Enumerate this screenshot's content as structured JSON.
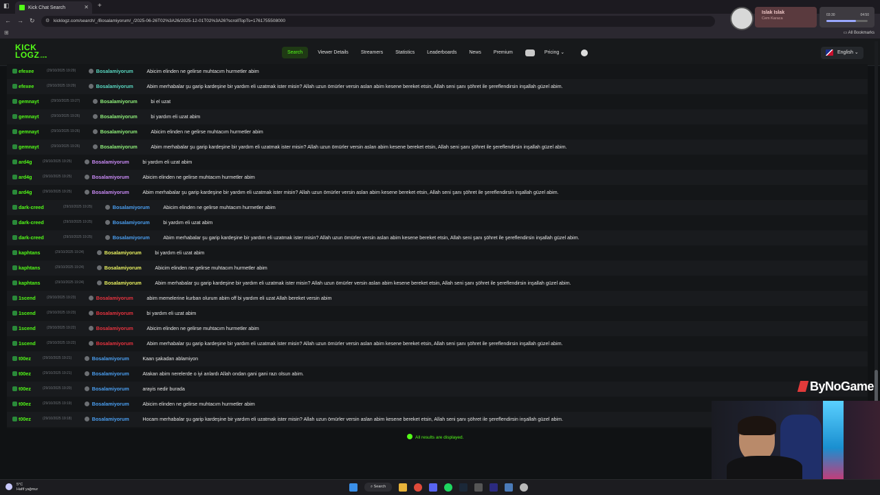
{
  "browser": {
    "tab_title": "Kick Chat Search",
    "url": "kicklogz.com/search/_/Bosalamiyorum/_/2025-06-26T02%3A26/2025-12-01T02%3A26?scrollTopTs=1761755508000",
    "all_bookmarks": "All Bookmarks"
  },
  "media": {
    "title": "Islak Islak",
    "artist": "Cem Karaca",
    "elapsed": "03:30",
    "duration": "04:50",
    "progress": 0.72
  },
  "site": {
    "logo_top": "KICK",
    "logo_bottom": "LOGZ",
    "logo_suffix": ".com",
    "nav": [
      "Search",
      "Viewer Details",
      "Streamers",
      "Statistics",
      "Leaderboards",
      "News",
      "Premium"
    ],
    "pricing": "Pricing",
    "language": "English"
  },
  "chat": {
    "rows": [
      {
        "user": "efexee",
        "ts": "(29/10/2025 19:29)",
        "target": "Bosalamiyorum",
        "color": "#5ad9c2",
        "msg": "Abicim elinden ne gelirse muhtacım hurmetler abim"
      },
      {
        "user": "efexee",
        "ts": "(29/10/2025 19:29)",
        "target": "Bosalamiyorum",
        "color": "#5ad9c2",
        "msg": "Abim merhabalar şu garip kardeşine bir yardım eli uzatmak ister misin? Allah uzun ömürler versin aslan abim kesene bereket etsin, Allah seni şanı şöhret ile şereflendirsin inşallah güzel abim."
      },
      {
        "user": "gemnayt",
        "ts": "(29/10/2025 19:27)",
        "target": "Bosalamiyorum",
        "color": "#8ff07a",
        "msg": "bi el uzat"
      },
      {
        "user": "gemnayt",
        "ts": "(29/10/2025 19:26)",
        "target": "Bosalamiyorum",
        "color": "#8ff07a",
        "msg": "bi yardım eli uzat abim"
      },
      {
        "user": "gemnayt",
        "ts": "(29/10/2025 19:26)",
        "target": "Bosalamiyorum",
        "color": "#8ff07a",
        "msg": "Abicim elinden ne gelirse muhtacım hurmetler abim"
      },
      {
        "user": "gemnayt",
        "ts": "(29/10/2025 19:26)",
        "target": "Bosalamiyorum",
        "color": "#8ff07a",
        "msg": "Abim merhabalar şu garip kardeşine bir yardım eli uzatmak ister misin? Allah uzun ömürler versin aslan abim kesene bereket etsin, Allah seni şanı şöhret ile şereflendirsin inşallah güzel abim."
      },
      {
        "user": "ard4g",
        "ts": "(29/10/2025 19:25)",
        "target": "Bosalamiyorum",
        "color": "#c98af5",
        "msg": "bi yardım eli uzat abim"
      },
      {
        "user": "ard4g",
        "ts": "(29/10/2025 19:25)",
        "target": "Bosalamiyorum",
        "color": "#c98af5",
        "msg": "Abicim elinden ne gelirse muhtacım hurmetler abim"
      },
      {
        "user": "ard4g",
        "ts": "(29/10/2025 19:25)",
        "target": "Bosalamiyorum",
        "color": "#c98af5",
        "msg": "Abim merhabalar şu garip kardeşine bir yardım eli uzatmak ister misin? Allah uzun ömürler versin aslan abim kesene bereket etsin, Allah seni şanı şöhret ile şereflendirsin inşallah güzel abim."
      },
      {
        "user": "dark-creed",
        "ts": "(29/10/2025 19:25)",
        "target": "Bosalamiyorum",
        "color": "#4a9ef0",
        "msg": "Abicim elinden ne gelirse muhtacım hurmetler abim"
      },
      {
        "user": "dark-creed",
        "ts": "(29/10/2025 19:25)",
        "target": "Bosalamiyorum",
        "color": "#4a9ef0",
        "msg": "bi yardım eli uzat abim"
      },
      {
        "user": "dark-creed",
        "ts": "(29/10/2025 19:25)",
        "target": "Bosalamiyorum",
        "color": "#4a9ef0",
        "msg": "Abim merhabalar şu garip kardeşine bir yardım eli uzatmak ister misin? Allah uzun ömürler versin aslan abim kesene bereket etsin, Allah seni şanı şöhret ile şereflendirsin inşallah güzel abim."
      },
      {
        "user": "kaphtans",
        "ts": "(29/10/2025 19:24)",
        "target": "Bosalamiyorum",
        "color": "#e8f060",
        "msg": "bi yardım eli uzat abim"
      },
      {
        "user": "kaphtans",
        "ts": "(29/10/2025 19:24)",
        "target": "Bosalamiyorum",
        "color": "#e8f060",
        "msg": "Abicim elinden ne gelirse muhtacım hurmetler abim"
      },
      {
        "user": "kaphtans",
        "ts": "(29/10/2025 19:24)",
        "target": "Bosalamiyorum",
        "color": "#e8f060",
        "msg": "Abim merhabalar şu garip kardeşine bir yardım eli uzatmak ister misin? Allah uzun ömürler versin aslan abim kesene bereket etsin, Allah seni şanı şöhret ile şereflendirsin inşallah güzel abim."
      },
      {
        "user": "1scend",
        "ts": "(29/10/2025 19:23)",
        "target": "Bosalamiyorum",
        "color": "#e8333f",
        "msg": "abim memelerine kurban olurum abim off bi yardım eli uzat Allah bereket versin abim"
      },
      {
        "user": "1scend",
        "ts": "(29/10/2025 19:23)",
        "target": "Bosalamiyorum",
        "color": "#e8333f",
        "msg": "bi yardım eli uzat abim"
      },
      {
        "user": "1scend",
        "ts": "(29/10/2025 19:22)",
        "target": "Bosalamiyorum",
        "color": "#e8333f",
        "msg": "Abicim elinden ne gelirse muhtacım hurmetler abim"
      },
      {
        "user": "1scend",
        "ts": "(29/10/2025 19:22)",
        "target": "Bosalamiyorum",
        "color": "#e8333f",
        "msg": "Abim merhabalar şu garip kardeşine bir yardım eli uzatmak ister misin? Allah uzun ömürler versin aslan abim kesene bereket etsin, Allah seni şanı şöhret ile şereflendirsin inşallah güzel abim."
      },
      {
        "user": "t00ez",
        "ts": "(29/10/2025 19:21)",
        "target": "Bosalamiyorum",
        "color": "#4a9ef0",
        "msg": "Kaan şakadan ablamiyon"
      },
      {
        "user": "t00ez",
        "ts": "(29/10/2025 19:21)",
        "target": "Bosalamiyorum",
        "color": "#4a9ef0",
        "msg": "Atakan abim nerelerde o iyi anlardı Allah ondan gani gani razı olsun abim."
      },
      {
        "user": "t00ez",
        "ts": "(29/10/2025 19:20)",
        "target": "Bosalamiyorum",
        "color": "#4a9ef0",
        "msg": "arayis nedir burada"
      },
      {
        "user": "t00ez",
        "ts": "(29/10/2025 19:19)",
        "target": "Bosalamiyorum",
        "color": "#4a9ef0",
        "msg": "Abicim elinden ne gelirse muhtacım hurmetler abim"
      },
      {
        "user": "t00ez",
        "ts": "(29/10/2025 19:18)",
        "target": "Bosalamiyorum",
        "color": "#4a9ef0",
        "msg": "Hocam merhabalar şu garip kardeşine bir yardım eli uzatmak ister misin? Allah uzun ömürler versin aslan abim kesene bereket etsin, Allah seni şanı şöhret ile şereflendirsin inşallah güzel abim."
      }
    ],
    "all_results": "All results are displayed."
  },
  "overlay": {
    "watermark": "ByNoGame"
  },
  "taskbar": {
    "temp": "5°C",
    "weather": "Hafif yağmur",
    "search": "Search"
  }
}
